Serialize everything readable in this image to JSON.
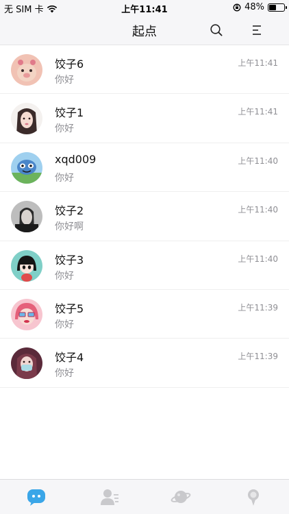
{
  "status_bar": {
    "carrier": "无 SIM 卡",
    "time": "上午11:41",
    "battery_text": "48%",
    "battery_level": 0.48
  },
  "nav": {
    "title": "起点",
    "search_icon": "search-icon",
    "menu_icon": "menu-icon"
  },
  "chats": [
    {
      "name": "饺子6",
      "message": "你好",
      "time": "上午11:41",
      "avatar": "avatar-6"
    },
    {
      "name": "饺子1",
      "message": "你好",
      "time": "上午11:41",
      "avatar": "avatar-1"
    },
    {
      "name": "xqd009",
      "message": "你好",
      "time": "上午11:40",
      "avatar": "avatar-xqd009"
    },
    {
      "name": "饺子2",
      "message": "你好啊",
      "time": "上午11:40",
      "avatar": "avatar-2"
    },
    {
      "name": "饺子3",
      "message": "你好",
      "time": "上午11:40",
      "avatar": "avatar-3"
    },
    {
      "name": "饺子5",
      "message": "你好",
      "time": "上午11:39",
      "avatar": "avatar-5"
    },
    {
      "name": "饺子4",
      "message": "你好",
      "time": "上午11:39",
      "avatar": "avatar-4"
    }
  ],
  "tabs": [
    {
      "icon": "chat-bubble-icon",
      "active": true,
      "color": "#3aa6e8"
    },
    {
      "icon": "contacts-icon",
      "active": false,
      "color": "#c9c9cc"
    },
    {
      "icon": "planet-icon",
      "active": false,
      "color": "#c9c9cc"
    },
    {
      "icon": "profile-icon",
      "active": false,
      "color": "#c9c9cc"
    }
  ]
}
